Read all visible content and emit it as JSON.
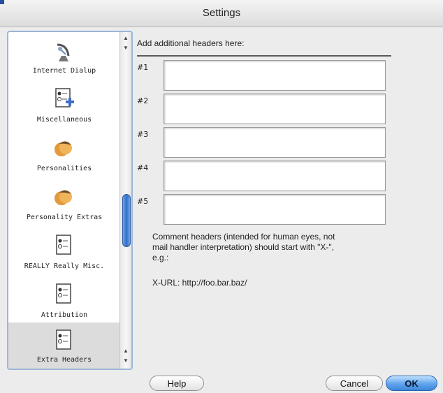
{
  "window": {
    "title": "Settings"
  },
  "sidebar": {
    "items": [
      {
        "label": "Internet Dialup",
        "icon": "satellite-dish-icon"
      },
      {
        "label": "Miscellaneous",
        "icon": "document-add-icon"
      },
      {
        "label": "Personalities",
        "icon": "personalities-icon"
      },
      {
        "label": "Personality Extras",
        "icon": "personalities-icon"
      },
      {
        "label": "REALLY Really Misc.",
        "icon": "document-icon"
      },
      {
        "label": "Attribution",
        "icon": "document-icon"
      },
      {
        "label": "Extra Headers",
        "icon": "document-icon",
        "selected": true
      }
    ]
  },
  "main": {
    "title": "Add additional headers here:",
    "headers": [
      {
        "num": "#1",
        "value": ""
      },
      {
        "num": "#2",
        "value": ""
      },
      {
        "num": "#3",
        "value": ""
      },
      {
        "num": "#4",
        "value": ""
      },
      {
        "num": "#5",
        "value": ""
      }
    ],
    "comment": "Comment headers (intended for human eyes, not\nmail handler interpretation) should start with \"X-\",\ne.g.:",
    "example": "X-URL: http://foo.bar.baz/"
  },
  "buttons": {
    "help": "Help",
    "cancel": "Cancel",
    "ok": "OK"
  },
  "colors": {
    "accent": "#3c86d9",
    "selection": "#dcdcdc",
    "sidebar_border": "#9bb6d8"
  }
}
